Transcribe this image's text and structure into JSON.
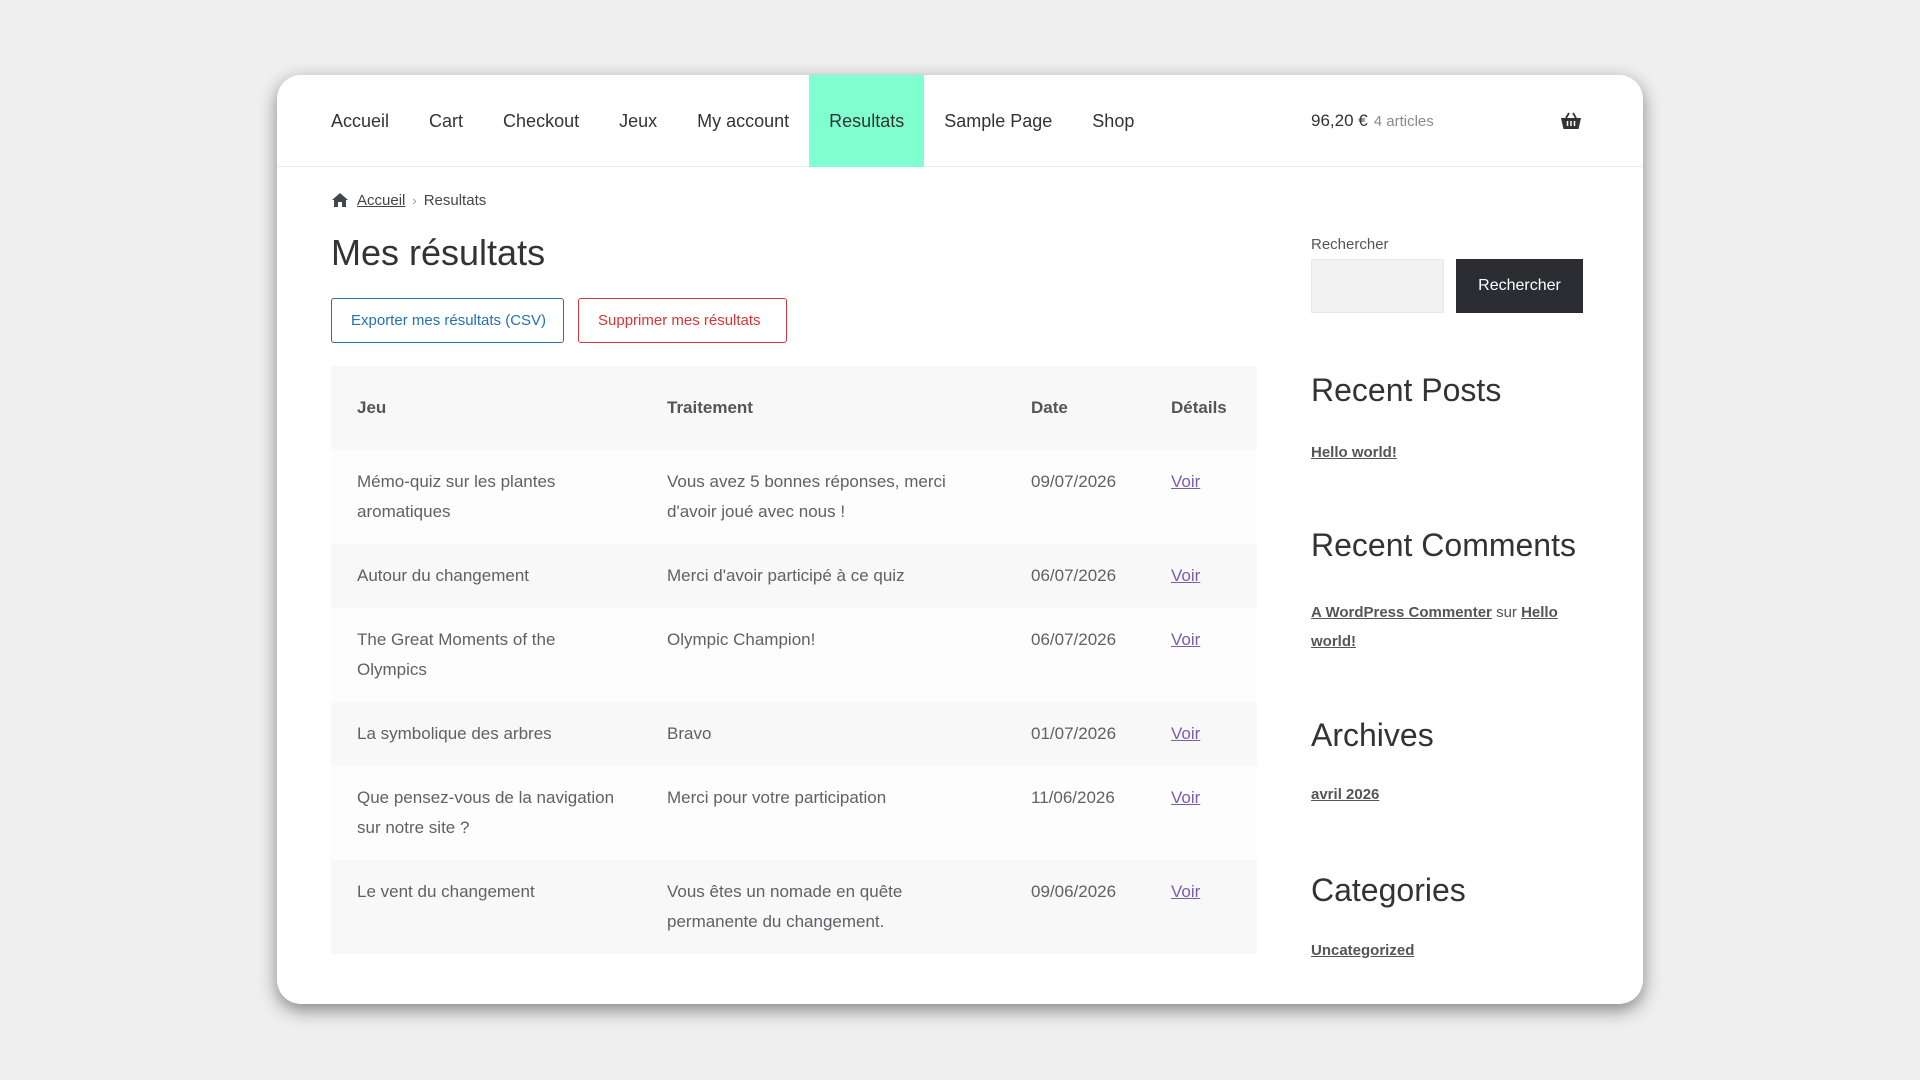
{
  "nav": {
    "items": [
      {
        "label": "Accueil"
      },
      {
        "label": "Cart"
      },
      {
        "label": "Checkout"
      },
      {
        "label": "Jeux"
      },
      {
        "label": "My account"
      },
      {
        "label": "Resultats"
      },
      {
        "label": "Sample Page"
      },
      {
        "label": "Shop"
      }
    ],
    "active": "Resultats"
  },
  "cart": {
    "amount": "96,20 €",
    "count": "4 articles"
  },
  "breadcrumb": {
    "home": "Accueil",
    "current": "Resultats"
  },
  "page": {
    "title": "Mes résultats"
  },
  "actions": {
    "export_label": "Exporter mes résultats (CSV)",
    "delete_label": "Supprimer mes résultats"
  },
  "table": {
    "headers": [
      "Jeu",
      "Traitement",
      "Date",
      "Détails"
    ],
    "rows": [
      {
        "jeu": "Mémo-quiz sur les plantes aromatiques",
        "traitement": "Vous avez 5 bonnes réponses, merci d'avoir joué avec nous !",
        "date": "09/07/2026",
        "details": "Voir"
      },
      {
        "jeu": "Autour du changement",
        "traitement": "Merci d'avoir participé à ce quiz",
        "date": "06/07/2026",
        "details": "Voir"
      },
      {
        "jeu": "The Great Moments of the Olympics",
        "traitement": "Olympic Champion!",
        "date": "06/07/2026",
        "details": "Voir"
      },
      {
        "jeu": "La symbolique des arbres",
        "traitement": "Bravo",
        "date": "01/07/2026",
        "details": "Voir"
      },
      {
        "jeu": "Que pensez-vous de la navigation sur notre site ?",
        "traitement": "Merci pour votre participation",
        "date": "11/06/2026",
        "details": "Voir"
      },
      {
        "jeu": "Le vent du changement",
        "traitement": "Vous êtes un nomade en quête permanente du changement.",
        "date": "09/06/2026",
        "details": "Voir"
      }
    ]
  },
  "sidebar": {
    "search_label": "Rechercher",
    "search_button": "Rechercher",
    "recent_posts_title": "Recent Posts",
    "recent_posts": [
      "Hello world!"
    ],
    "recent_comments_title": "Recent Comments",
    "comment": {
      "author": "A WordPress Commenter",
      "connector": "sur",
      "post": "Hello world!"
    },
    "archives_title": "Archives",
    "archives": [
      "avril 2026"
    ],
    "categories_title": "Categories",
    "categories": [
      "Uncategorized"
    ]
  },
  "colors": {
    "active_nav": "#80ffd0",
    "export": "#2271b1",
    "delete": "#d63638",
    "search_button": "#2c2d33"
  }
}
